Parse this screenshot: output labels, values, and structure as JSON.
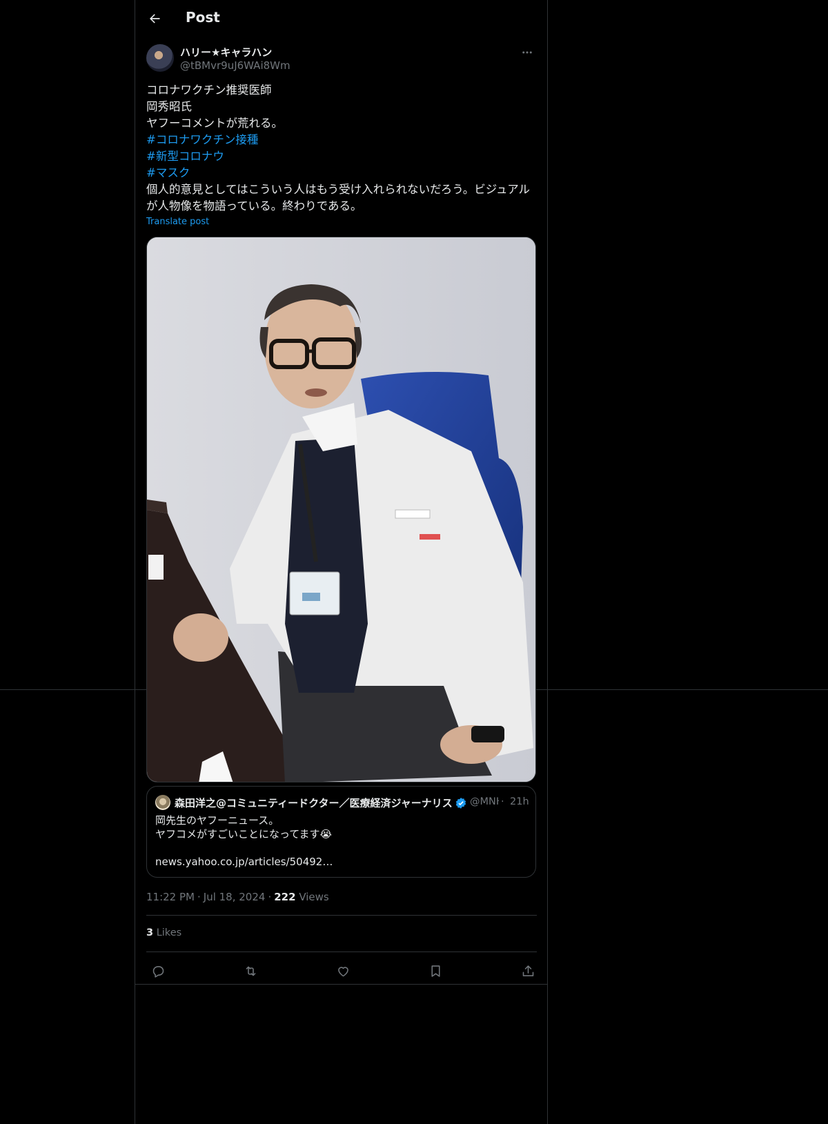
{
  "header": {
    "title": "Post"
  },
  "author": {
    "display_name": "ハリー★キャラハン",
    "handle": "@tBMvr9uJ6WAi8Wm"
  },
  "tweet": {
    "lines": [
      "コロナワクチン推奨医師",
      "岡秀昭氏",
      "ヤフーコメントが荒れる。"
    ],
    "hashtags": [
      "#コロナワクチン接種",
      "#新型コロナウ",
      "#マスク"
    ],
    "closing": "個人的意見としてはこういう人はもう受け入れられないだろう。ビジュアルが人物像を物語っている。終わりである。",
    "translate_label": "Translate post"
  },
  "quote": {
    "display_name": "森田洋之@コミュニティードクター／医療経済ジャーナリス",
    "handle": "@MNHMorita",
    "dot": "·",
    "time": "21h",
    "lines": [
      "岡先生のヤフーニュース。",
      "ヤフコメがすごいことになってます😭",
      "",
      "news.yahoo.co.jp/articles/50492…"
    ]
  },
  "meta": {
    "time": "11:22 PM",
    "date": "Jul 18, 2024",
    "views_count": "222",
    "views_label": "Views",
    "separator": "·"
  },
  "likes": {
    "count": "3",
    "label": "Likes"
  },
  "colors": {
    "background": "#000000",
    "text": "#e7e9ea",
    "muted": "#71767b",
    "accent": "#1d9bf0",
    "border": "#2f3336"
  },
  "icons": {
    "back": "back-arrow-icon",
    "more": "more-icon",
    "reply": "reply-icon",
    "repost": "repost-icon",
    "like": "like-icon",
    "bookmark": "bookmark-icon",
    "share": "share-icon",
    "verified": "verified-badge-icon"
  }
}
